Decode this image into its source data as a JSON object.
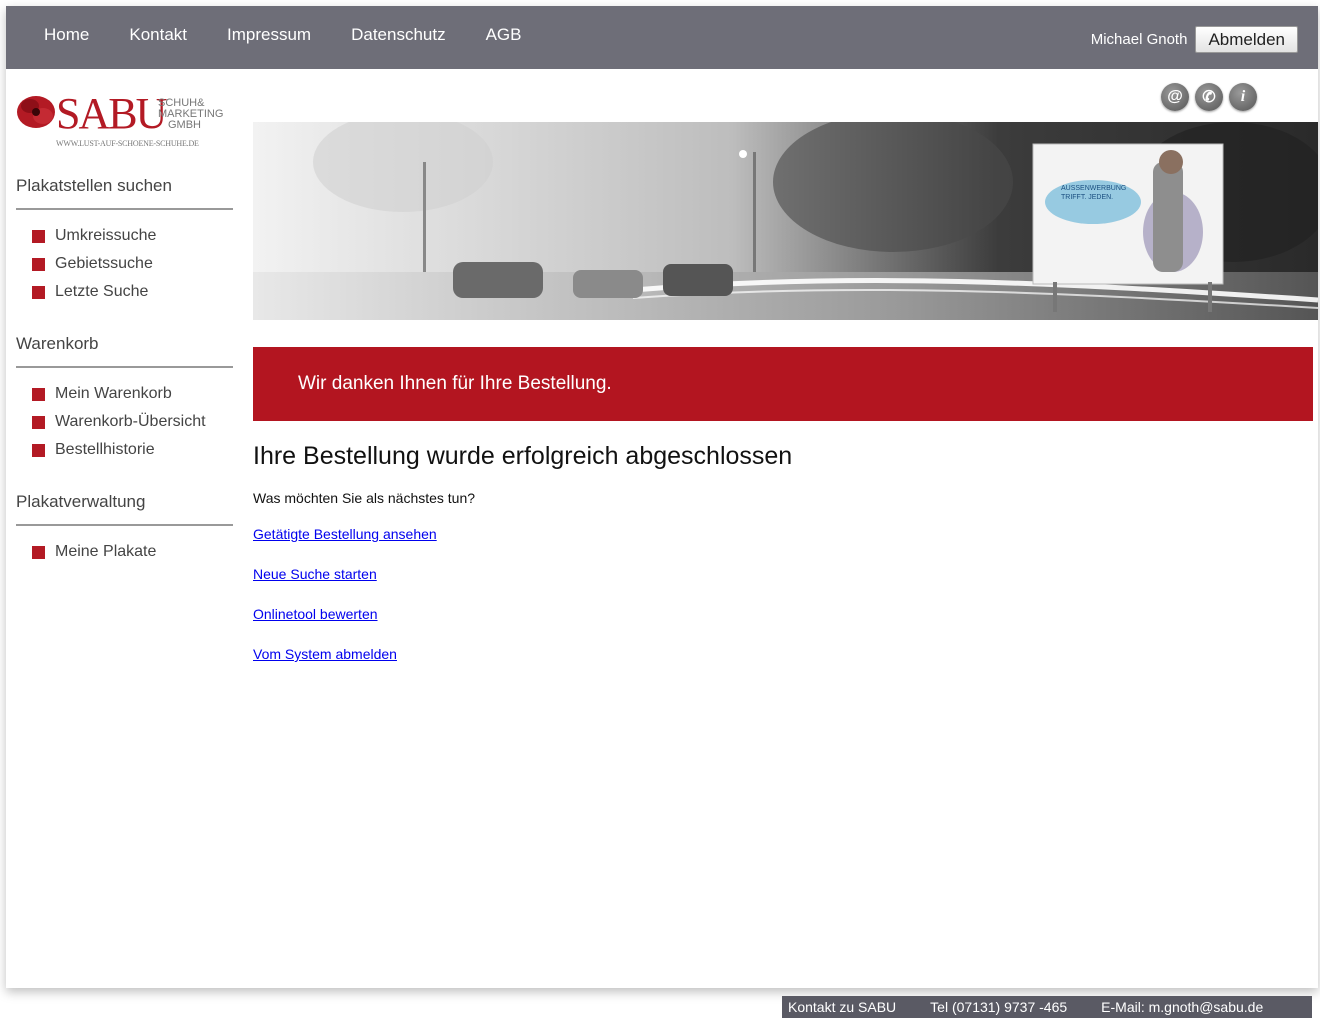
{
  "topnav": {
    "items": [
      "Home",
      "Kontakt",
      "Impressum",
      "Datenschutz",
      "AGB"
    ]
  },
  "user": {
    "name": "Michael Gnoth",
    "logout_label": "Abmelden"
  },
  "logo": {
    "name": "SABU",
    "subtitle_line1": "SCHUH&",
    "subtitle_line2": "MARKETING",
    "subtitle_line3": "GMBH",
    "url": "WWW.LUST-AUF-SCHOENE-SCHUHE.DE"
  },
  "sidebar": {
    "sections": [
      {
        "heading": "Plakatstellen suchen",
        "items": [
          "Umkreissuche",
          "Gebietssuche",
          "Letzte Suche"
        ]
      },
      {
        "heading": "Warenkorb",
        "items": [
          "Mein Warenkorb",
          "Warenkorb-Übersicht",
          "Bestellhistorie"
        ]
      },
      {
        "heading": "Plakatverwaltung",
        "items": [
          "Meine Plakate"
        ]
      }
    ]
  },
  "icons": [
    "email-icon",
    "phone-icon",
    "info-icon"
  ],
  "banner": {
    "billboard_text_line1": "AUSSENWERBUNG",
    "billboard_text_line2": "TRIFFT. JEDEN."
  },
  "notice": "Wir danken Ihnen für Ihre Bestellung.",
  "main": {
    "title": "Ihre Bestellung wurde erfolgreich abgeschlossen",
    "question": "Was möchten Sie als nächstes tun?",
    "links": [
      "Getätigte Bestellung ansehen",
      "Neue Suche starten",
      "Onlinetool bewerten",
      "Vom System abmelden"
    ]
  },
  "footer": {
    "contact": "Kontakt zu SABU",
    "phone": "Tel (07131) 9737 -465",
    "email": "E-Mail: m.gnoth@sabu.de"
  },
  "colors": {
    "topbar": "#6e6e78",
    "accent_red": "#b31520",
    "link": "#0000ee"
  }
}
